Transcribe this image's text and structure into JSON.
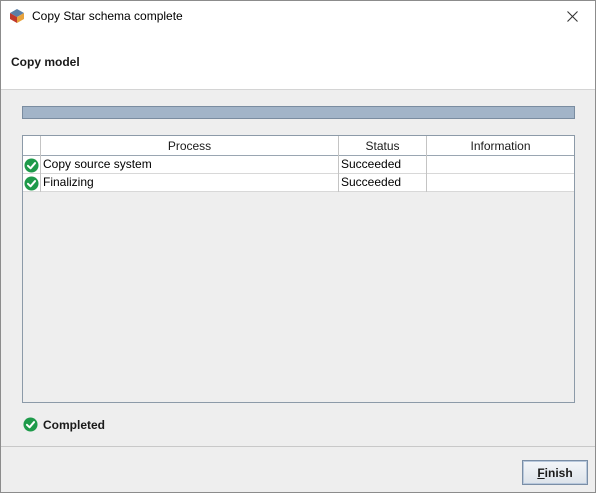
{
  "window": {
    "title": "Copy Star schema complete"
  },
  "header": {
    "title": "Copy model"
  },
  "progress": {
    "fraction": 1.0,
    "fill_color": "#a2b4c8"
  },
  "table": {
    "columns": {
      "process": "Process",
      "status": "Status",
      "information": "Information"
    },
    "rows": [
      {
        "icon": "success-check-icon",
        "process": "Copy source system",
        "status": "Succeeded",
        "information": ""
      },
      {
        "icon": "success-check-icon",
        "process": "Finalizing",
        "status": "Succeeded",
        "information": ""
      }
    ]
  },
  "status": {
    "icon": "success-check-icon",
    "label": "Completed"
  },
  "buttons": {
    "finish_mnemonic": "F",
    "finish_rest": "inish"
  },
  "colors": {
    "success": "#1e9a4a"
  }
}
